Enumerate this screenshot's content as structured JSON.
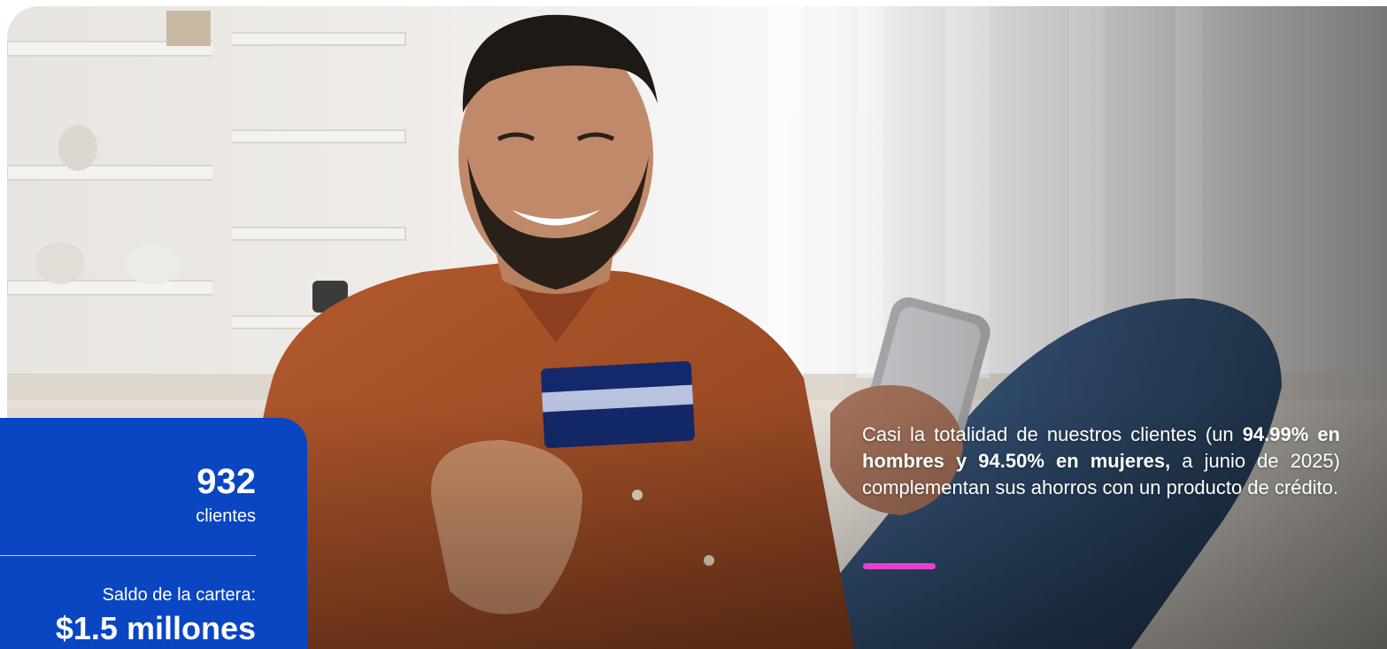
{
  "stats": {
    "clients_number": "932",
    "clients_label": "clientes",
    "balance_label": "Saldo de la cartera:",
    "balance_value": "$1.5 millones"
  },
  "info": {
    "text_before": "Casi la totalidad de nuestros clientes (un ",
    "text_bold": "94.99% en hombres y 94.50% en mujeres,",
    "text_after": " a junio de 2025) complementan sus ahorros con un producto de crédito."
  },
  "hero": {
    "image_subject": "smiling-man-with-credit-card-and-phone"
  },
  "colors": {
    "card_blue": "#0a45c2",
    "accent_pink": "#e83fd1",
    "text_white": "#ffffff"
  }
}
